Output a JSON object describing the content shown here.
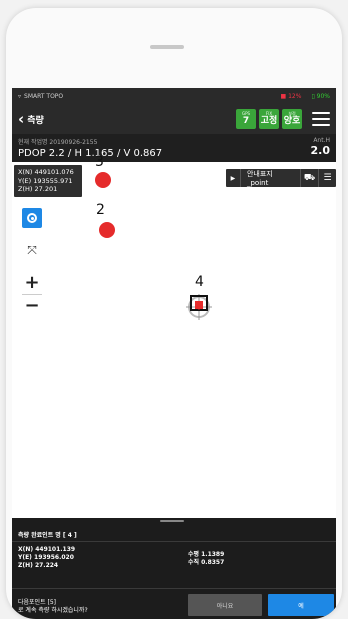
{
  "statusbar": {
    "app_name": "SMART TOPO",
    "battery1": "12%",
    "battery2": "90%"
  },
  "appbar": {
    "title": "측량",
    "badges": [
      {
        "top": "GPS",
        "value": "7"
      },
      {
        "top": "FIX",
        "value": "고정"
      },
      {
        "top": "보정",
        "value": "양호"
      }
    ]
  },
  "info": {
    "timestamp": "현재 작업명 20190926-2155",
    "dop": "PDOP 2.2 / H 1.165 / V 0.867",
    "ant_label": "Ant.H",
    "ant_value": "2.0"
  },
  "map": {
    "coords": [
      "X(N) 449101.076",
      "Y(E) 193555.971",
      "Z(H) 27.201"
    ],
    "point_name": "안내표지_point",
    "points": [
      {
        "label": "3"
      },
      {
        "label": "2"
      },
      {
        "label": "4"
      }
    ],
    "zoom_in": "+",
    "zoom_out": "−"
  },
  "bottom": {
    "done_title": "측량 완료인트 명 [ 4 ]",
    "xyz": [
      "X(N) 449101.139",
      "Y(E) 193956.020",
      "Z(H) 27.224"
    ],
    "hv": [
      "수평 1.1389",
      "수직 0.8357"
    ],
    "next_line1": "다음포인트 [5]",
    "next_line2": "로 계속 측량 하시겠습니까?",
    "no_label": "아니요",
    "yes_label": "예"
  },
  "colors": {
    "badge_green": "#3aa63a",
    "point_red": "#e52b2b",
    "accent_blue": "#1e88e5"
  }
}
